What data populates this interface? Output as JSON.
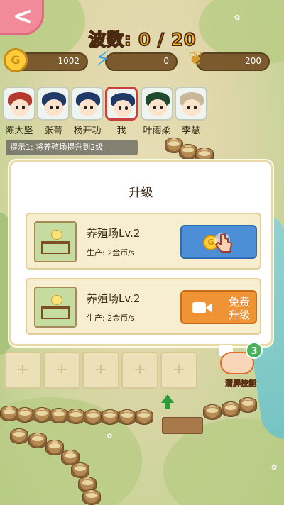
{
  "wave": {
    "label": "波数:",
    "current": "0",
    "total": "20",
    "text": "波数: 0 / 20"
  },
  "resources": {
    "coins": {
      "icon": "coin-icon",
      "letter": "G",
      "value": "1002"
    },
    "energy": {
      "icon": "lightning-icon",
      "value": "0"
    },
    "grain": {
      "icon": "wheat-icon",
      "value": "200"
    }
  },
  "characters": [
    {
      "name": "陈大坚",
      "hair": "#b23a2e",
      "selected": false
    },
    {
      "name": "张菁",
      "hair": "#1f3a66",
      "selected": false
    },
    {
      "name": "杨开功",
      "hair": "#1f3a66",
      "selected": false
    },
    {
      "name": "我",
      "hair": "#1f3a66",
      "selected": true
    },
    {
      "name": "叶雨柔",
      "hair": "#1f4a2e",
      "selected": false
    },
    {
      "name": "李慧",
      "hair": "#c9b79a",
      "selected": false
    }
  ],
  "tip": "提示1: 将养殖场提升到2级",
  "dialog": {
    "title": "升级",
    "cards": [
      {
        "name": "养殖场Lv.2",
        "production": "生产: 2金币/s",
        "button": "coin-upgrade",
        "coin_letter": "G"
      },
      {
        "name": "养殖场Lv.2",
        "production": "生产: 2金币/s",
        "button": "free-upgrade",
        "button_text": "免费升级",
        "button_line1": "免费",
        "button_line2": "升级"
      }
    ]
  },
  "skill": {
    "label": "清屏技能",
    "count": "3"
  },
  "colors": {
    "coin_button": "#4d8fd6",
    "free_button": "#f09335",
    "wave_text": "#ffb21f",
    "selected_border": "#c8413d"
  }
}
